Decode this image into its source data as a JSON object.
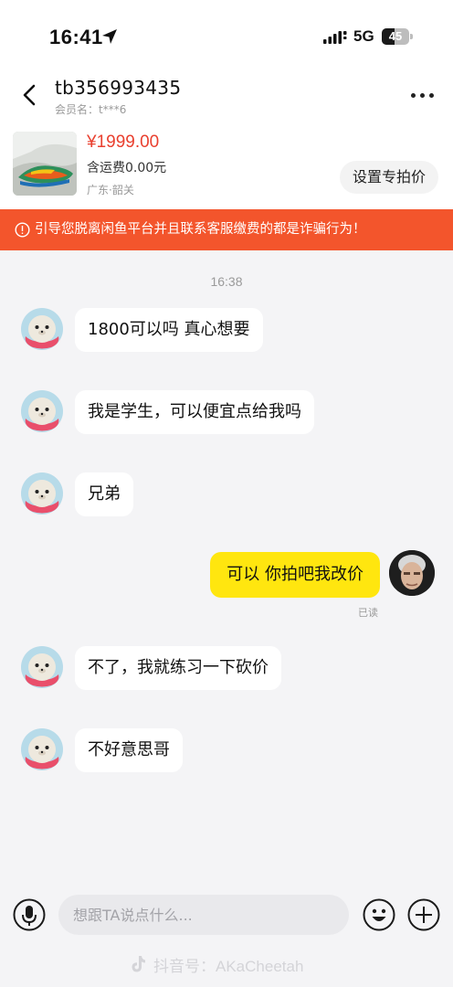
{
  "status_bar": {
    "time": "16:41",
    "network": "5G",
    "battery": "45",
    "battery_level": 0.45
  },
  "header": {
    "title": "tb356993435",
    "member_label": "会员名：",
    "member_value": "t***6"
  },
  "product": {
    "price": "¥1999.00",
    "shipping": "含运费0.00元",
    "location": "广东·韶关",
    "set_price_button": "设置专拍价"
  },
  "warning_banner": {
    "text": "引导您脱离闲鱼平台并且联系客服缴费的都是诈骗行为！"
  },
  "chat": {
    "timestamp": "16:38",
    "messages": [
      {
        "sender": "them",
        "text": "1800可以吗 真心想要"
      },
      {
        "sender": "them",
        "text": "我是学生，可以便宜点给我吗"
      },
      {
        "sender": "them",
        "text": "兄弟"
      },
      {
        "sender": "me",
        "text": "可以  你拍吧我改价",
        "status": "已读"
      },
      {
        "sender": "them",
        "text": "不了，我就练习一下砍价"
      },
      {
        "sender": "them",
        "text": "不好意思哥"
      }
    ]
  },
  "input_bar": {
    "placeholder": "想跟TA说点什么..."
  },
  "watermark": {
    "text": "抖音号：AKaCheetah"
  },
  "colors": {
    "price": "#e9402f",
    "warning_bg": "#f3552c",
    "outgoing_bubble": "#ffe60f",
    "incoming_bubble": "#ffffff",
    "background": "#f4f4f6"
  },
  "icons": {
    "back": "chevron-left-icon",
    "more": "more-dots-icon",
    "warning": "info-circle-icon",
    "voice": "microphone-icon",
    "emoji": "smiley-icon",
    "plus": "plus-circle-icon",
    "location": "location-arrow-icon"
  }
}
